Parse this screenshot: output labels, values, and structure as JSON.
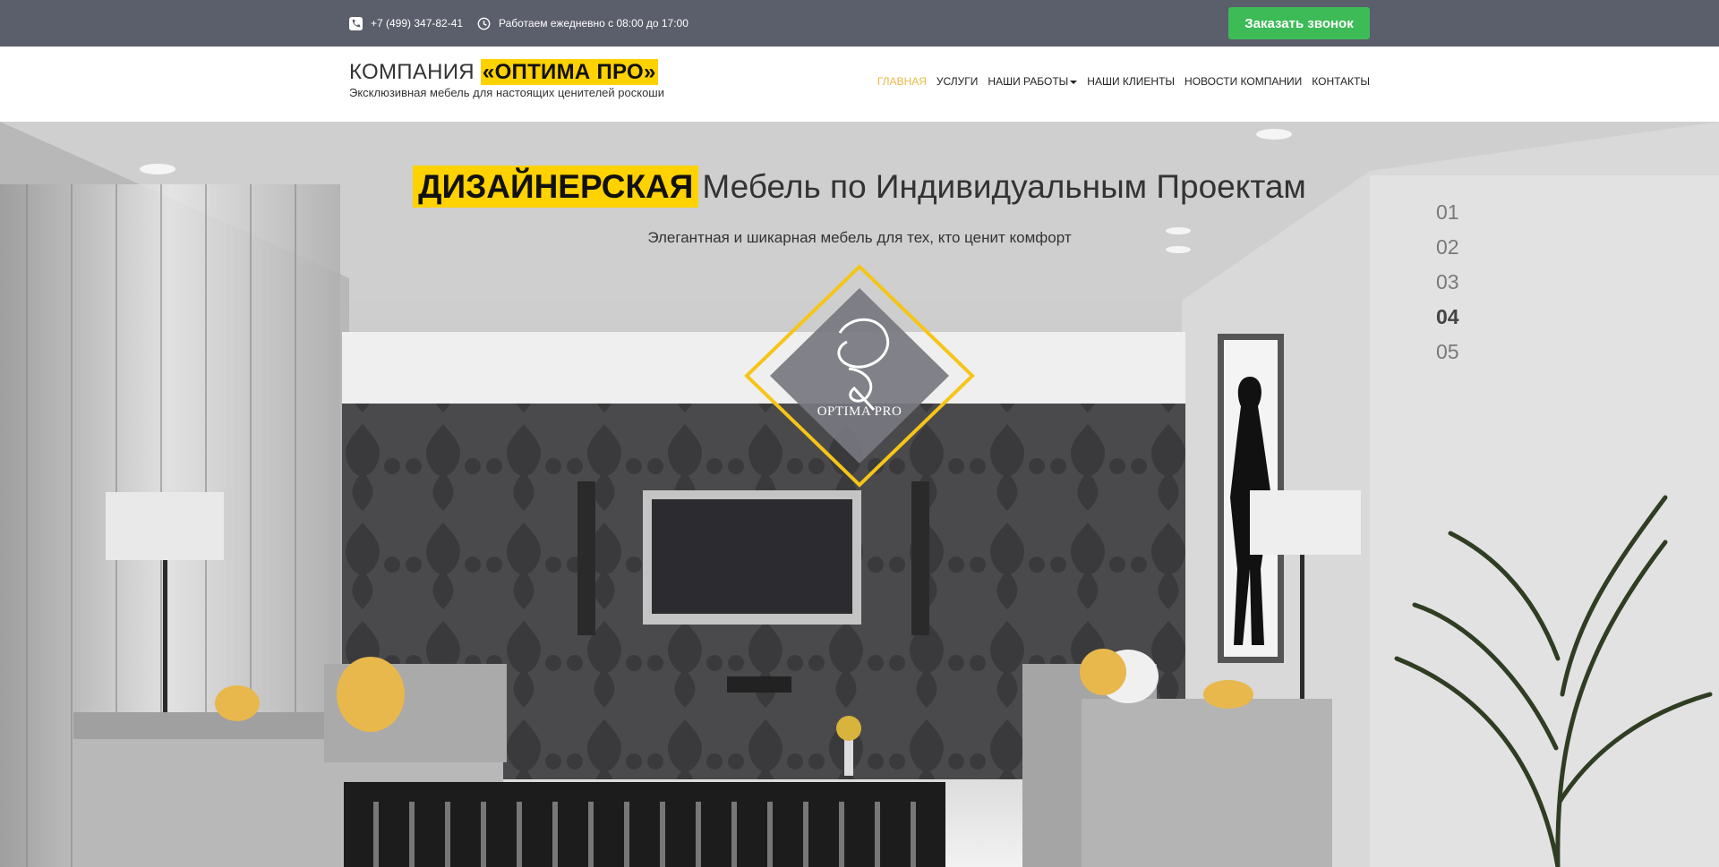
{
  "topbar": {
    "phone": "+7 (499) 347-82-41",
    "hours": "Работаем ежедневно с 08:00 до 17:00",
    "callback_label": "Заказать звонок"
  },
  "brand": {
    "name_prefix": "КОМПАНИЯ",
    "name_highlight": "«ОПТИМА ПРО»",
    "tagline": "Эксклюзивная мебель для настоящих ценителей роскоши"
  },
  "nav": {
    "items": [
      {
        "label": "ГЛАВНАЯ",
        "active": true
      },
      {
        "label": "УСЛУГИ"
      },
      {
        "label": "НАШИ РАБОТЫ",
        "dropdown": true
      },
      {
        "label": "НАШИ КЛИЕНТЫ"
      },
      {
        "label": "НОВОСТИ КОМПАНИИ"
      },
      {
        "label": "КОНТАКТЫ"
      }
    ]
  },
  "hero": {
    "title_highlight": "ДИЗАЙНЕРСКАЯ",
    "title_rest": "Мебель по Индивидуальным Проектам",
    "subtitle": "Элегантная и шикарная мебель для тех, кто ценит комфорт",
    "logo_text": "OPTIMA PRO",
    "slides": [
      "01",
      "02",
      "03",
      "04",
      "05"
    ],
    "active_slide": "04"
  },
  "colors": {
    "topbar": "#5b5e6b",
    "accent": "#ffd200",
    "button": "#3dbb57",
    "active_nav": "#e8b94a"
  }
}
